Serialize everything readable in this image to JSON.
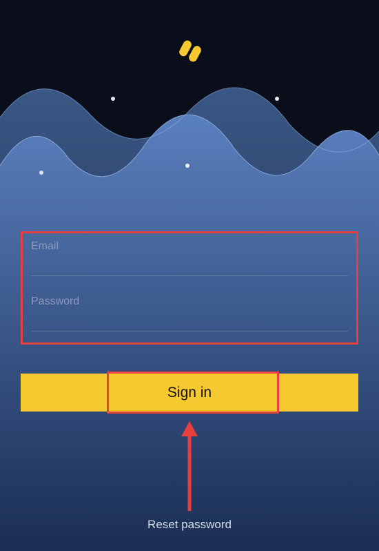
{
  "logo": {
    "name": "app-logo-icon"
  },
  "form": {
    "email": {
      "label": "Email",
      "value": ""
    },
    "password": {
      "label": "Password",
      "value": ""
    },
    "signin_label": "Sign in"
  },
  "links": {
    "reset_password": "Reset password"
  },
  "colors": {
    "accent": "#f7c931",
    "highlight": "#e83e3e",
    "wave_light": "#5a7fbf",
    "wave_dark": "#2d4a7a"
  }
}
